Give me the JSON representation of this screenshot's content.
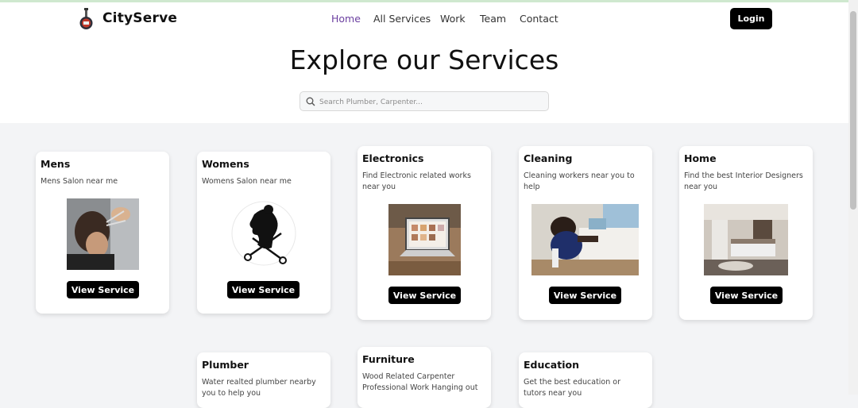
{
  "app": {
    "brand": "CityServe"
  },
  "nav": {
    "items": [
      "Home",
      "All Services",
      "Work",
      "Team",
      "Contact"
    ],
    "active": "Home"
  },
  "header": {
    "login_label": "Login"
  },
  "hero": {
    "title": "Explore our Services",
    "search_placeholder": "Search Plumber, Carpenter..."
  },
  "services": [
    {
      "title": "Mens",
      "description": "Mens Salon near me",
      "button": "View Service"
    },
    {
      "title": "Womens",
      "description": "Womens Salon near me",
      "button": "View Service"
    },
    {
      "title": "Electronics",
      "description": "Find Electronic related works near you",
      "button": "View Service"
    },
    {
      "title": "Cleaning",
      "description": "Cleaning workers near you to help",
      "button": "View Service"
    },
    {
      "title": "Home",
      "description": "Find the best Interior Designers near you",
      "button": "View Service"
    },
    {
      "title": "Plumber",
      "description": "Water realted plumber nearby you to help you"
    },
    {
      "title": "Furniture",
      "description": "Wood Related Carpenter Professional Work Hanging out"
    },
    {
      "title": "Education",
      "description": "Get the best education or tutors near you"
    }
  ],
  "colors": {
    "accent": "#6b3fa0",
    "button": "#000000",
    "background": "#f3f4f6"
  }
}
